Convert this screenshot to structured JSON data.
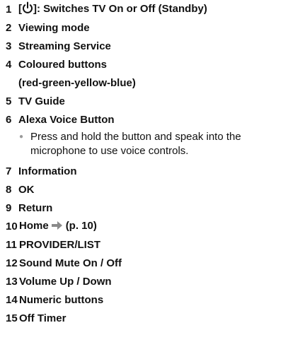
{
  "items": [
    {
      "num": "1",
      "pre": "[",
      "post": "]: Switches TV On or Off (Standby)",
      "icon": "power-icon"
    },
    {
      "num": "2",
      "label": "Viewing mode"
    },
    {
      "num": "3",
      "label": "Streaming Service"
    },
    {
      "num": "4",
      "label": "Coloured buttons",
      "cont": "(red-green-yellow-blue)"
    },
    {
      "num": "5",
      "label": "TV Guide"
    },
    {
      "num": "6",
      "label": "Alexa Voice Button",
      "bullet": "Press and hold the button and speak into the microphone to use voice controls."
    },
    {
      "num": "7",
      "label": "Information"
    },
    {
      "num": "8",
      "label": "OK"
    },
    {
      "num": "9",
      "label": "Return"
    },
    {
      "num": "10",
      "label": "Home",
      "ref": "(p. 10)",
      "icon": "arrow-right-icon"
    },
    {
      "num": "11",
      "label": "PROVIDER/LIST"
    },
    {
      "num": "12",
      "label": "Sound Mute On / Off"
    },
    {
      "num": "13",
      "label": "Volume Up / Down"
    },
    {
      "num": "14",
      "label": "Numeric buttons"
    },
    {
      "num": "15",
      "label": "Off Timer"
    }
  ],
  "colors": {
    "arrow": "#8a8a8a",
    "text": "#111111"
  }
}
